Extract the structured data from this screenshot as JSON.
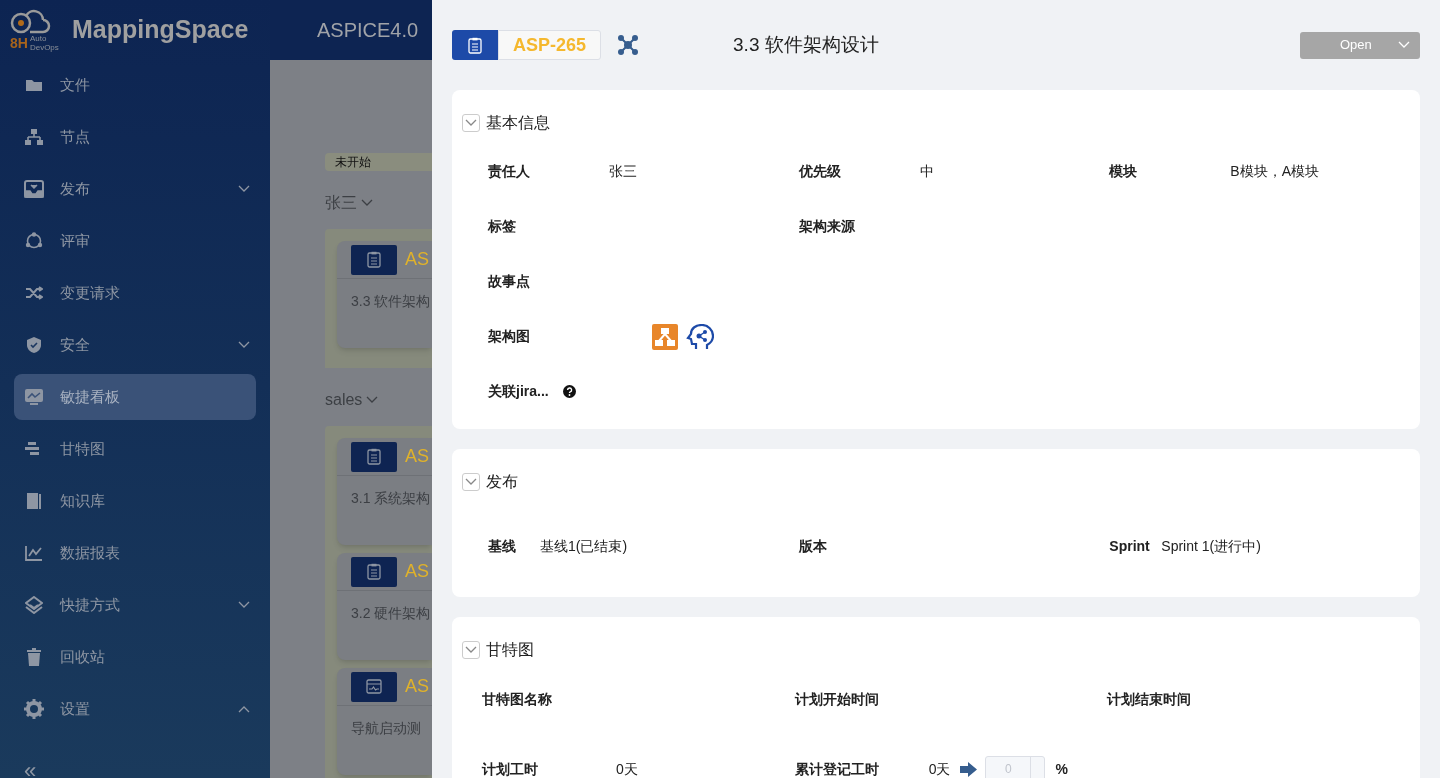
{
  "header": {
    "logo_mark": "8H",
    "logo_sub": "Auto DevOps",
    "brand": "MappingSpace",
    "project": "ASPICE4.0"
  },
  "sidebar": {
    "items": [
      {
        "label": "文件",
        "selected": false
      },
      {
        "label": "节点",
        "selected": false
      },
      {
        "label": "发布",
        "selected": false,
        "expanded": false
      },
      {
        "label": "评审",
        "selected": false
      },
      {
        "label": "变更请求",
        "selected": false
      },
      {
        "label": "安全",
        "selected": false,
        "expanded": false
      },
      {
        "label": "敏捷看板",
        "selected": true
      },
      {
        "label": "甘特图",
        "selected": false
      },
      {
        "label": "知识库",
        "selected": false
      },
      {
        "label": "数据报表",
        "selected": false
      },
      {
        "label": "快捷方式",
        "selected": false,
        "expanded": false
      },
      {
        "label": "回收站",
        "selected": false
      },
      {
        "label": "设置",
        "selected": false,
        "expanded": true
      }
    ],
    "collapse": "«"
  },
  "board": {
    "column": "未开始",
    "groups": [
      {
        "name": "张三",
        "cards": [
          {
            "kind": "doc",
            "key": "AS",
            "title": "3.3 软件架构"
          }
        ]
      },
      {
        "name": "sales",
        "cards": [
          {
            "kind": "doc",
            "key": "AS",
            "title": "3.1 系统架构"
          },
          {
            "kind": "doc",
            "key": "AS",
            "title": "3.2 硬件架构"
          },
          {
            "kind": "test",
            "key": "AS",
            "title": "导航启动测"
          }
        ]
      }
    ]
  },
  "drawer": {
    "key": "ASP-265",
    "title": "3.3 软件架构设计",
    "status": "Open",
    "sections": [
      {
        "title": "基本信息",
        "expanded": true,
        "rows": [
          [
            {
              "label": "责任人",
              "value": "张三"
            },
            {
              "label": "优先级",
              "value": "中"
            },
            {
              "label": "模块",
              "value": "B模块，A模块"
            }
          ],
          [
            {
              "label": "标签"
            },
            {
              "label": "架构来源"
            }
          ],
          [
            {
              "label": "故事点"
            }
          ],
          [
            {
              "label": "架构图",
              "kind": "icons"
            }
          ],
          [
            {
              "label": "关联jira...",
              "kind": "help"
            }
          ]
        ]
      },
      {
        "title": "发布",
        "expanded": true,
        "rows": [
          [
            {
              "label": "基线",
              "value": "基线1(已结束)"
            },
            {
              "label": "版本"
            },
            {
              "label": "Sprint",
              "value": "Sprint 1(进行中)"
            }
          ]
        ]
      },
      {
        "title": "甘特图",
        "expanded": true,
        "rows": [
          [
            {
              "label": "甘特图名称"
            },
            {
              "label": "计划开始时间"
            },
            {
              "label": "计划结束时间"
            }
          ],
          [
            {
              "label": "计划工时",
              "value": "0天"
            },
            {
              "label": "累计登记工时",
              "value": "0天",
              "kind": "progress",
              "input": "0",
              "unit": "%"
            }
          ]
        ]
      }
    ]
  }
}
